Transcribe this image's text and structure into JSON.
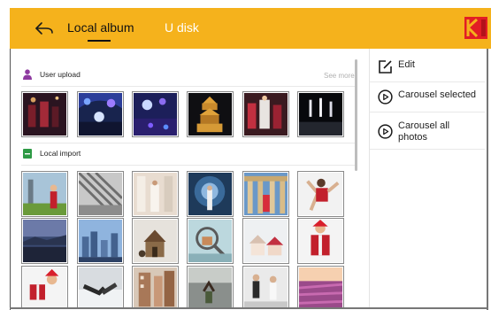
{
  "header": {
    "tabs": [
      {
        "label": "Local album",
        "active": true
      },
      {
        "label": "U disk",
        "active": false
      }
    ],
    "accent_color": "#f5b21c",
    "logo_icon": "kodak-logo"
  },
  "sections": {
    "user_upload": {
      "title": "User upload",
      "see_more": "See more",
      "icon": "user-icon",
      "icon_color": "#8e3aa0"
    },
    "local_import": {
      "title": "Local import",
      "icon": "folder-icon",
      "icon_color": "#2e9a45"
    }
  },
  "actions": [
    {
      "label": "Edit",
      "icon": "edit-icon"
    },
    {
      "label": "Carousel selected",
      "icon": "play-circle-icon"
    },
    {
      "label": "Carousel all photos",
      "icon": "play-circle-icon"
    }
  ]
}
